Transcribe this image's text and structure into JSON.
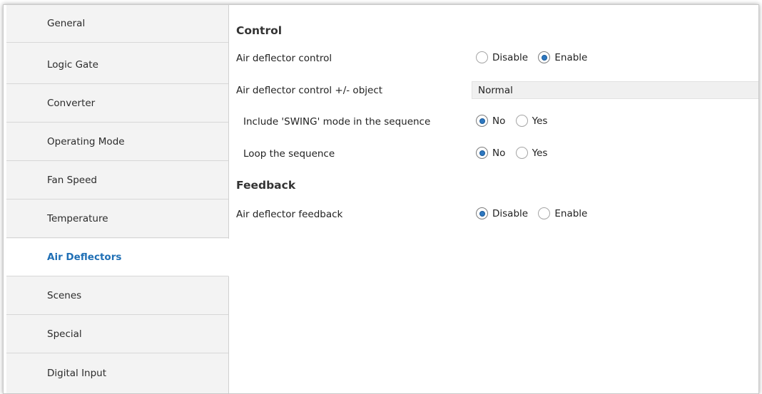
{
  "sidebar": {
    "items": [
      {
        "label": "General",
        "active": false
      },
      {
        "label": "Logic Gate",
        "active": false
      },
      {
        "label": "Converter",
        "active": false
      },
      {
        "label": "Operating Mode",
        "active": false
      },
      {
        "label": "Fan Speed",
        "active": false
      },
      {
        "label": "Temperature",
        "active": false
      },
      {
        "label": "Air Deflectors",
        "active": true
      },
      {
        "label": "Scenes",
        "active": false
      },
      {
        "label": "Special",
        "active": false
      },
      {
        "label": "Digital Input",
        "active": false
      }
    ]
  },
  "main": {
    "control_title": "Control",
    "feedback_title": "Feedback",
    "air_deflector_control": {
      "label": "Air deflector control",
      "options": [
        "Disable",
        "Enable"
      ],
      "selected": "Enable"
    },
    "control_object": {
      "label": "Air deflector control +/- object",
      "value": "Normal"
    },
    "include_swing": {
      "label": "Include 'SWING' mode in the sequence",
      "options": [
        "No",
        "Yes"
      ],
      "selected": "No"
    },
    "loop_sequence": {
      "label": "Loop the sequence",
      "options": [
        "No",
        "Yes"
      ],
      "selected": "No"
    },
    "air_deflector_feedback": {
      "label": "Air deflector feedback",
      "options": [
        "Disable",
        "Enable"
      ],
      "selected": "Disable"
    }
  },
  "colors": {
    "accent": "#1f6fb5",
    "radio_fill": "#2e78c0",
    "sidebar_bg": "#f3f3f3"
  }
}
